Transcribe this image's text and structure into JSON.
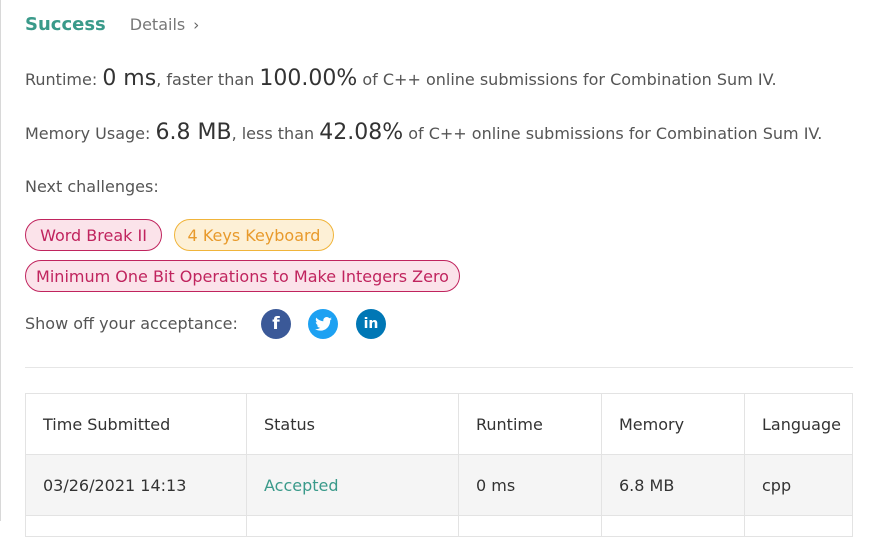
{
  "header": {
    "status": "Success",
    "details_label": "Details",
    "chevron": "›"
  },
  "runtime": {
    "label": "Runtime:",
    "value": "0 ms",
    "faster_text": ", faster than",
    "percent": "100.00%",
    "suffix": "of C++ online submissions for Combination Sum IV."
  },
  "memory": {
    "label": "Memory Usage:",
    "value": "6.8 MB",
    "less_text": ", less than",
    "percent": "42.08%",
    "suffix": "of C++ online submissions for Combination Sum IV."
  },
  "next_challenges": {
    "label": "Next challenges:",
    "items": [
      {
        "title": "Word Break II",
        "difficulty": "hard"
      },
      {
        "title": "4 Keys Keyboard",
        "difficulty": "medium"
      },
      {
        "title": "Minimum One Bit Operations to Make Integers Zero",
        "difficulty": "hard"
      }
    ]
  },
  "share": {
    "label": "Show off your acceptance:",
    "icons": [
      "facebook-icon",
      "twitter-icon",
      "linkedin-icon"
    ],
    "glyphs": {
      "facebook": "f",
      "linkedin": "in"
    }
  },
  "table": {
    "headers": [
      "Time Submitted",
      "Status",
      "Runtime",
      "Memory",
      "Language"
    ],
    "rows": [
      [
        "03/26/2021 14:13",
        "Accepted",
        "0 ms",
        "6.8 MB",
        "cpp"
      ]
    ]
  },
  "colors": {
    "accent": "#3a9a8a",
    "hard": "#c0245e",
    "medium": "#e89a2c"
  }
}
